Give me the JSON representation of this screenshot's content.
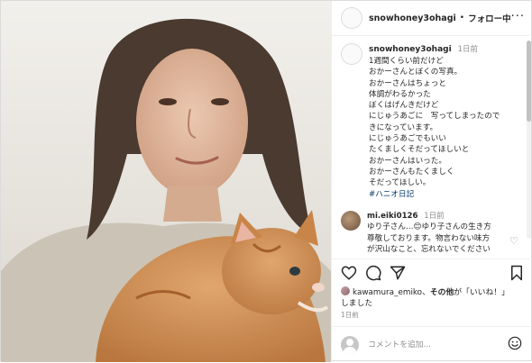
{
  "header": {
    "username": "snowhoney3ohagi",
    "separator": "•",
    "follow_status": "フォロー中",
    "more": "···"
  },
  "caption": {
    "username": "snowhoney3ohagi",
    "time": "1日前",
    "lines": [
      "1週間くらい前だけど",
      "おかーさんとぼくの写真。",
      "おかーさんはちょっと",
      "体調がわるかった",
      "ぼくはげんきだけど",
      "にじゅうあごに　写ってしまったので",
      "きになっています。",
      "にじゅうあごでもいい",
      "たくましくそだってほしいと",
      "おかーさんはいった。",
      "おかーさんもたくましく",
      "そだってほしい。"
    ],
    "hashtag": "#ハニオ日記"
  },
  "comment": {
    "username": "mi.eiki0126",
    "time": "1日前",
    "lines": [
      "ゆり子さん…😊ゆり子さんの生き方",
      "尊敬しております。物言わない味方",
      "が沢山なこと、忘れないでください"
    ]
  },
  "likes": {
    "liker": "kawamura_emiko",
    "conj": "、",
    "others": "その他",
    "suffix1": "が「いいね！」",
    "suffix2": "しました"
  },
  "post_time": "1日前",
  "add_comment": {
    "placeholder": "コメントを追加..."
  },
  "colors": {
    "text": "#262626",
    "secondary": "#8e8e8e",
    "hashtag": "#00376b",
    "border": "#dbdbdb"
  },
  "icons": [
    "heart-icon",
    "comment-icon",
    "share-icon",
    "bookmark-icon",
    "emoji-icon",
    "more-icon"
  ]
}
